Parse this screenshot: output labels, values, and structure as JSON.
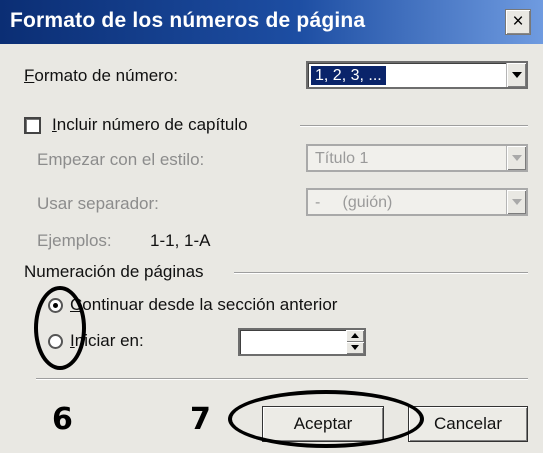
{
  "dialog": {
    "title": "Formato de los números de página",
    "close_glyph": "×"
  },
  "number_format": {
    "label_accel": "F",
    "label_rest": "ormato de número:",
    "value": "1, 2, 3, ..."
  },
  "chapter": {
    "checkbox_checked": false,
    "label_accel": "I",
    "label_rest": "ncluir número de capítulo",
    "start_style_label": "Empezar con el estilo:",
    "start_style_value": "Título 1",
    "separator_label": "Usar separador:",
    "separator_value": "-     (guión)",
    "examples_label": "Ejemplos:",
    "examples_value": "1-1, 1-A"
  },
  "page_numbering": {
    "group_label": "Numeración de páginas",
    "options": [
      {
        "accel": "C",
        "rest": "ontinuar desde la sección anterior",
        "checked": true
      },
      {
        "accel": "I",
        "rest": "niciar en:",
        "checked": false
      }
    ],
    "start_at_value": ""
  },
  "buttons": {
    "ok": "Aceptar",
    "cancel": "Cancelar"
  },
  "annotations": {
    "step_6": "6",
    "step_7": "7"
  }
}
